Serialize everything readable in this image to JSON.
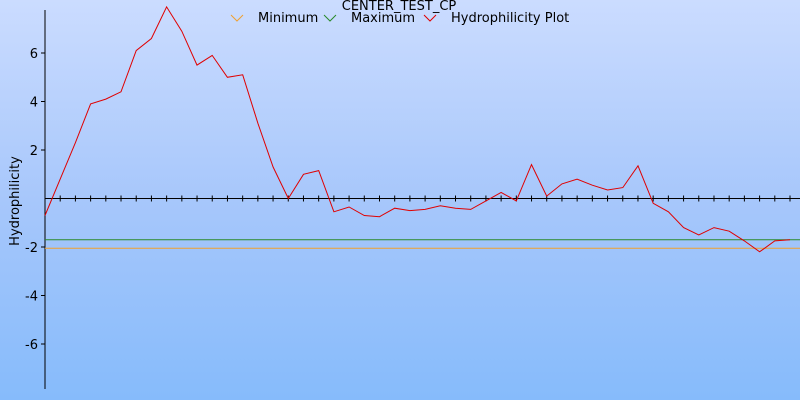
{
  "chart_data": {
    "type": "line",
    "title": "CENTER_TEST_CP",
    "ylabel": "Hydrophilicity",
    "xlabel": "",
    "ylim": [
      -7.9,
      7.9
    ],
    "yticks": [
      -6,
      -4,
      -2,
      2,
      4,
      6
    ],
    "legend_position": "top",
    "legend": [
      "Minimum",
      "Maximum",
      "Hydrophilicity Plot"
    ],
    "colors": {
      "minimum": "#f0a030",
      "maximum": "#2a8a2a",
      "plot": "#e00000"
    },
    "minimum": -2.05,
    "maximum": -1.7,
    "series": [
      {
        "name": "Hydrophilicity Plot",
        "values": [
          -0.7,
          0.8,
          2.3,
          3.9,
          4.1,
          4.4,
          6.1,
          6.6,
          7.9,
          6.9,
          5.5,
          5.9,
          5.0,
          5.1,
          3.1,
          1.3,
          0.0,
          1.0,
          1.15,
          -0.55,
          -0.35,
          -0.7,
          -0.75,
          -0.4,
          -0.5,
          -0.45,
          -0.3,
          -0.4,
          -0.45,
          -0.1,
          0.25,
          -0.1,
          1.4,
          0.1,
          0.6,
          0.8,
          0.55,
          0.35,
          0.45,
          1.35,
          -0.2,
          -0.55,
          -1.2,
          -1.5,
          -1.2,
          -1.35,
          -1.75,
          -2.2,
          -1.75,
          -1.7
        ]
      }
    ]
  }
}
